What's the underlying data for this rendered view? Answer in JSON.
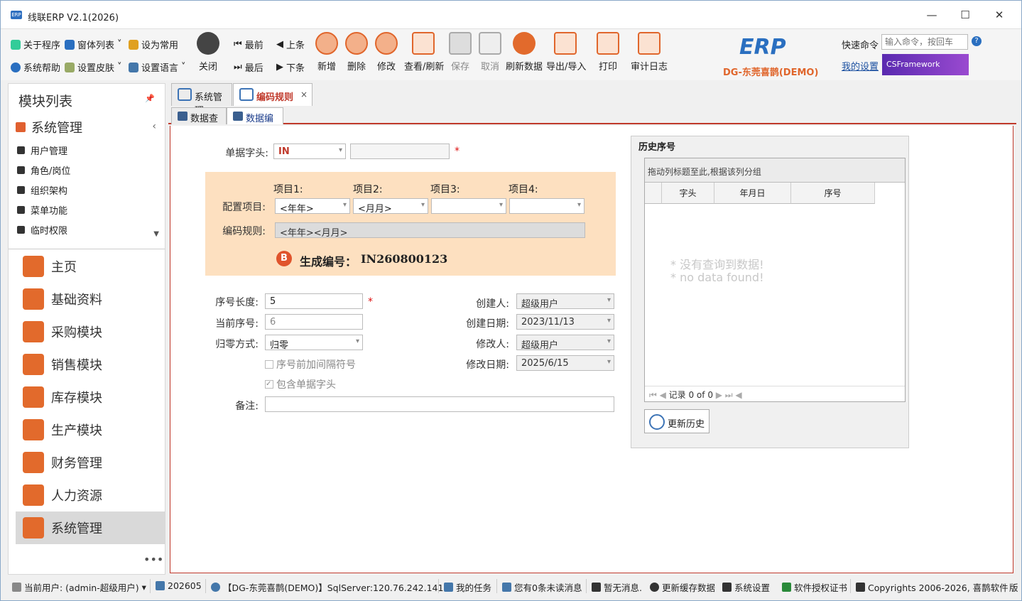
{
  "window": {
    "title": "线联ERP V2.1(2026)",
    "logo_text": "ERP"
  },
  "ribbon": {
    "small": [
      {
        "label": "关于程序",
        "icon": "info-icon"
      },
      {
        "label": "窗体列表",
        "icon": "windows-icon",
        "dropdown": true
      },
      {
        "label": "设为常用",
        "icon": "clipboard-icon"
      },
      {
        "label": "系统帮助",
        "icon": "help-icon"
      },
      {
        "label": "设置皮肤",
        "icon": "skin-icon",
        "dropdown": true
      },
      {
        "label": "设置语言",
        "icon": "language-icon",
        "dropdown": true
      }
    ],
    "nav": {
      "first": "最前",
      "prev": "上条",
      "last": "最后",
      "next": "下条"
    },
    "buttons": [
      {
        "label": "关闭",
        "icon": "power-icon"
      },
      {
        "label": "新增",
        "icon": "db-add-icon"
      },
      {
        "label": "删除",
        "icon": "db-delete-icon"
      },
      {
        "label": "修改",
        "icon": "db-edit-icon"
      },
      {
        "label": "查看/刷新",
        "icon": "view-refresh-icon"
      },
      {
        "label": "保存",
        "icon": "save-icon"
      },
      {
        "label": "取消",
        "icon": "cancel-icon"
      },
      {
        "label": "刷新数据",
        "icon": "refresh-icon"
      },
      {
        "label": "导出/导入",
        "icon": "export-import-icon"
      },
      {
        "label": "打印",
        "icon": "print-icon"
      },
      {
        "label": "审计日志",
        "icon": "audit-log-icon"
      }
    ],
    "brand": {
      "logo": "ERP",
      "company": "DG-东莞喜鹊(DEMO)"
    },
    "quick_cmd_label": "快速命令",
    "quick_cmd_placeholder": "输入命令，按回车",
    "my_settings": "我的设置",
    "framework": "CSFramework"
  },
  "sidebar": {
    "title": "模块列表",
    "group": "系统管理",
    "sub_items": [
      "用户管理",
      "角色/岗位",
      "组织架构",
      "菜单功能",
      "临时权限"
    ],
    "modules": [
      {
        "label": "主页",
        "icon": "home-icon"
      },
      {
        "label": "基础资料",
        "icon": "folder-icon"
      },
      {
        "label": "采购模块",
        "icon": "cart-icon"
      },
      {
        "label": "销售模块",
        "icon": "sales-bag-icon"
      },
      {
        "label": "库存模块",
        "icon": "warehouse-icon"
      },
      {
        "label": "生产模块",
        "icon": "production-icon"
      },
      {
        "label": "财务管理",
        "icon": "money-bag-icon"
      },
      {
        "label": "人力资源",
        "icon": "people-icon"
      },
      {
        "label": "系统管理",
        "icon": "system-icon"
      }
    ],
    "more": "•••"
  },
  "tabs": [
    {
      "label": "系统管理"
    },
    {
      "label": "编码规则"
    }
  ],
  "subtabs": [
    {
      "label": "数据查询"
    },
    {
      "label": "数据编辑"
    }
  ],
  "form": {
    "prefix_label": "单据字头:",
    "prefix_value": "IN",
    "prefix_desc": "",
    "items_headers": [
      "项目1:",
      "项目2:",
      "项目3:",
      "项目4:"
    ],
    "config_label": "配置项目:",
    "config_values": [
      "<年年>",
      "<月月>",
      "",
      ""
    ],
    "rule_label": "编码规则:",
    "rule_value": "<年年><月月>",
    "generated_label": "生成编号：",
    "generated_value": "IN260800123",
    "seq_len_label": "序号长度:",
    "seq_len_value": "5",
    "cur_seq_label": "当前序号:",
    "cur_seq_value": "6",
    "reset_label": "归零方式:",
    "reset_value": "归零",
    "chk_sep_label": "序号前加间隔符号",
    "chk_prefix_label": "包含单据字头",
    "remark_label": "备注:",
    "remark_value": "",
    "creator_label": "创建人:",
    "creator_value": "超级用户",
    "create_date_label": "创建日期:",
    "create_date_value": "2023/11/13",
    "modifier_label": "修改人:",
    "modifier_value": "超级用户",
    "modify_date_label": "修改日期:",
    "modify_date_value": "2025/6/15"
  },
  "history": {
    "title": "历史序号",
    "group_hint": "拖动列标题至此,根据该列分组",
    "columns": [
      "字头",
      "年月日",
      "序号"
    ],
    "no_data_cn": "* 没有查询到数据!",
    "no_data_en": "* no data found!",
    "nav_text": "记录 0 of 0",
    "update_btn": "更新历史"
  },
  "status": [
    {
      "label": "当前用户: (admin-超级用户)",
      "icon": "user-icon"
    },
    {
      "label": "202605",
      "icon": "calendar-icon"
    },
    {
      "label": "【DG-东莞喜鹊(DEMO)】SqlServer:120.76.242.141",
      "icon": "database-icon"
    },
    {
      "label": "我的任务",
      "icon": "task-icon"
    },
    {
      "label": "您有0条未读消息",
      "icon": "message-icon"
    },
    {
      "label": "暂无消息.",
      "icon": "speaker-icon"
    },
    {
      "label": "更新缓存数据",
      "icon": "sync-icon"
    },
    {
      "label": "系统设置",
      "icon": "tools-icon"
    },
    {
      "label": "软件授权证书",
      "icon": "certificate-icon"
    },
    {
      "label": "Copyrights 2006-2026, 喜鹊软件",
      "icon": "cube-icon"
    },
    {
      "label": "版",
      "icon": ""
    }
  ]
}
